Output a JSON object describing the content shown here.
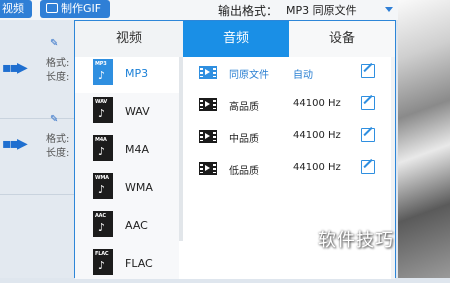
{
  "toolbar": {
    "video_button": "视频",
    "gif_button": "制作GIF",
    "output_format_label": "输出格式：",
    "output_format_value": "MP3  同原文件"
  },
  "side": {
    "rows": [
      {
        "format_key": "格式:",
        "length_key": "长度:"
      },
      {
        "format_key": "格式:",
        "length_key": "长度:"
      }
    ]
  },
  "popup": {
    "tabs": [
      "视频",
      "音频",
      "设备"
    ],
    "active_tab": "音频",
    "formats": [
      "MP3",
      "WAV",
      "M4A",
      "WMA",
      "AAC",
      "FLAC"
    ],
    "selected_format": "MP3",
    "qualities": [
      {
        "label": "同原文件",
        "rate": "自动"
      },
      {
        "label": "高品质",
        "rate": "44100 Hz"
      },
      {
        "label": "中品质",
        "rate": "44100 Hz"
      },
      {
        "label": "低品质",
        "rate": "44100 Hz"
      }
    ]
  },
  "watermark": "软件技巧",
  "colors": {
    "accent": "#1a8fe6",
    "selected_text": "#1a7fd6"
  },
  "icons": {
    "format": "music-file-icon",
    "quality": "film-icon",
    "edit": "edit-icon"
  }
}
